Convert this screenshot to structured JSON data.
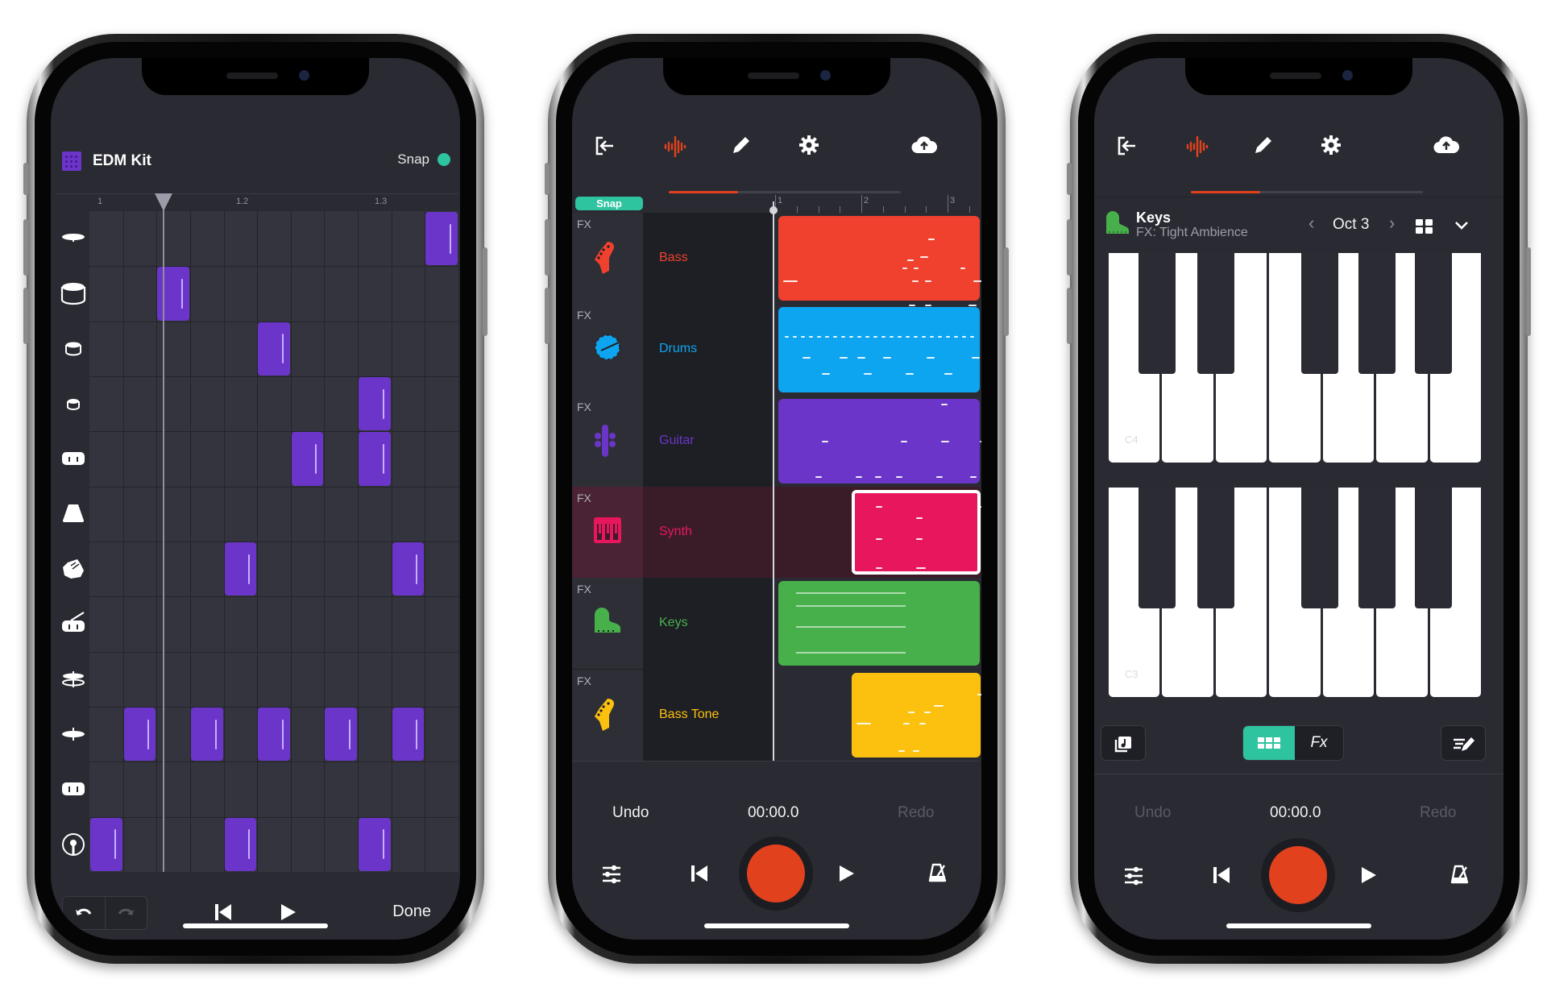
{
  "phones": {
    "drum": {
      "header": {
        "title": "EDM Kit",
        "snap_label": "Snap",
        "snap_on": true,
        "kit_icon": "drum-grid-icon"
      },
      "ruler": [
        "1",
        "1.2",
        "1.3"
      ],
      "rows": [
        {
          "instrument": "crash-cymbal",
          "steps": [
            10
          ]
        },
        {
          "instrument": "kick-drum",
          "steps": [
            2
          ]
        },
        {
          "instrument": "high-tom",
          "steps": [
            5
          ]
        },
        {
          "instrument": "low-tom",
          "steps": [
            8
          ]
        },
        {
          "instrument": "snare-drum",
          "steps": [
            6,
            8
          ]
        },
        {
          "instrument": "cowbell",
          "steps": []
        },
        {
          "instrument": "clap",
          "steps": [
            4,
            9
          ]
        },
        {
          "instrument": "rimshot",
          "steps": []
        },
        {
          "instrument": "hi-hat-open",
          "steps": []
        },
        {
          "instrument": "hi-hat-closed",
          "steps": [
            1,
            3,
            5,
            7,
            9
          ]
        },
        {
          "instrument": "floor-tom",
          "steps": []
        },
        {
          "instrument": "bass-drum",
          "steps": [
            0,
            4,
            8
          ]
        }
      ],
      "columns": 11,
      "footer": {
        "done_label": "Done"
      },
      "colors": {
        "pad": "#6a35c8",
        "snap": "#2ec4a0"
      }
    },
    "tracks": {
      "snap_label": "Snap",
      "ruler": [
        "1",
        "2",
        "3"
      ],
      "tracks": [
        {
          "fx_label": "FX",
          "name": "Bass",
          "icon": "bass-guitar-icon",
          "color": "#f0412e",
          "selected": false
        },
        {
          "fx_label": "FX",
          "name": "Drums",
          "icon": "drum-icon",
          "color": "#0ea5f0",
          "selected": false
        },
        {
          "fx_label": "FX",
          "name": "Guitar",
          "icon": "guitar-icon",
          "color": "#6a35c8",
          "selected": false
        },
        {
          "fx_label": "FX",
          "name": "Synth",
          "icon": "synth-icon",
          "color": "#e8175d",
          "selected": true
        },
        {
          "fx_label": "FX",
          "name": "Keys",
          "icon": "piano-icon",
          "color": "#47b04b",
          "selected": false
        },
        {
          "fx_label": "FX",
          "name": "Bass Tone",
          "icon": "bass-guitar-icon",
          "color": "#fcc10f",
          "selected": false
        }
      ],
      "transport": {
        "undo_label": "Undo",
        "redo_label": "Redo",
        "time": "00:00.0"
      }
    },
    "keys": {
      "instrument_name": "Keys",
      "fx_label": "FX: Tight Ambience",
      "octave_label": "Oct 3",
      "upper_keyboard_label": "C4",
      "lower_keyboard_label": "C3",
      "mode_fx_label": "Fx",
      "transport": {
        "undo_label": "Undo",
        "redo_label": "Redo",
        "time": "00:00.0"
      }
    }
  },
  "colors": {
    "accent_red": "#e2411d",
    "teal": "#2ec4a0",
    "screen_bg": "#2a2b32"
  }
}
